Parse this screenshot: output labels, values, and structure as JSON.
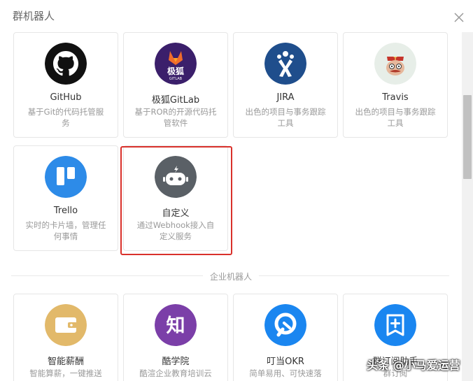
{
  "header": {
    "title": "群机器人"
  },
  "group_robots": [
    {
      "name": "GitHub",
      "desc": "基于Git的代码托管服务",
      "icon": "github-icon"
    },
    {
      "name": "极狐GitLab",
      "desc": "基于ROR的开源代码托管软件",
      "icon": "gitlab-fox-icon",
      "icon_text": "极狐",
      "icon_subtext": "GITLAB"
    },
    {
      "name": "JIRA",
      "desc": "出色的项目与事务跟踪工具",
      "icon": "jira-icon"
    },
    {
      "name": "Travis",
      "desc": "出色的项目与事务跟踪工具",
      "icon": "travis-icon"
    },
    {
      "name": "Trello",
      "desc": "实时的卡片墙，管理任何事情",
      "icon": "trello-icon"
    },
    {
      "name": "自定义",
      "desc": "通过Webhook接入自定义服务",
      "icon": "robot-icon",
      "selected": true
    }
  ],
  "enterprise_section": {
    "label": "企业机器人"
  },
  "enterprise_robots": [
    {
      "name": "智能薪酬",
      "desc": "智能算薪，一键推送",
      "icon": "wallet-icon"
    },
    {
      "name": "酷学院",
      "desc": "酷渲企业教育培训云",
      "icon": "zhi-icon",
      "icon_text": "知"
    },
    {
      "name": "叮当OKR",
      "desc": "简单易用、可快速落",
      "icon": "okr-icon"
    },
    {
      "name": "群订阅助手",
      "desc": "群订阅",
      "icon": "subscribe-plus-icon"
    }
  ],
  "watermark": "头条 @小马爱运营",
  "colors": {
    "github": "#111111",
    "gitlab": "#3b1f6b",
    "jira": "#1f4e8c",
    "travis": "#e7eee8",
    "trello": "#2d8be8",
    "robot": "#5a6066",
    "wallet": "#e2b96a",
    "zhi": "#7b3fa8",
    "okr": "#1a86f0",
    "subscribe": "#1a86f0",
    "selected_border": "#d9312b"
  }
}
